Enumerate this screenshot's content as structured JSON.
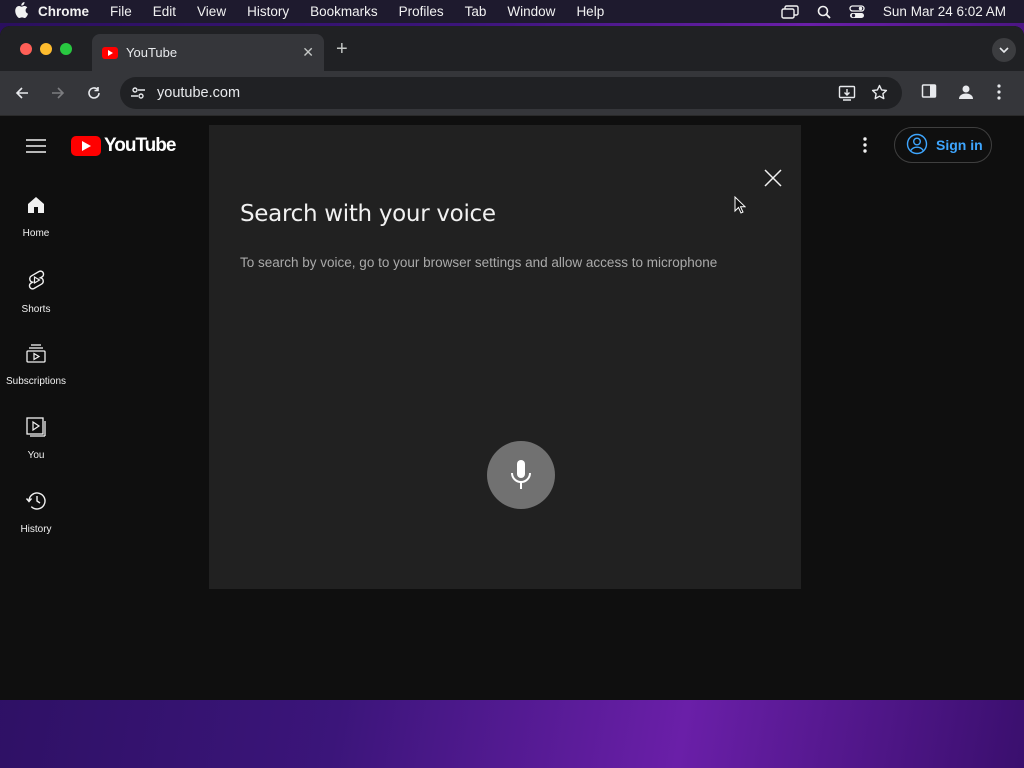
{
  "menubar": {
    "app_name": "Chrome",
    "items": [
      "File",
      "Edit",
      "View",
      "History",
      "Bookmarks",
      "Profiles",
      "Tab",
      "Window",
      "Help"
    ],
    "clock": "Sun Mar 24  6:02 AM"
  },
  "browser": {
    "tab_title": "YouTube",
    "url": "youtube.com"
  },
  "youtube": {
    "logo_text": "YouTube",
    "sign_in": "Sign in",
    "nav": [
      {
        "label": "Home",
        "icon": "home-icon"
      },
      {
        "label": "Shorts",
        "icon": "shorts-icon"
      },
      {
        "label": "Subscriptions",
        "icon": "subscriptions-icon"
      },
      {
        "label": "You",
        "icon": "you-icon"
      },
      {
        "label": "History",
        "icon": "history-icon"
      }
    ]
  },
  "voice_dialog": {
    "title": "Search with your voice",
    "message": "To search by voice, go to your browser settings and allow access to microphone"
  },
  "colors": {
    "page_bg": "#0f0f0f",
    "dialog_bg": "#212121",
    "youtube_red": "#ff0000",
    "sign_in_blue": "#3ea6ff",
    "mic_button": "#717171"
  }
}
